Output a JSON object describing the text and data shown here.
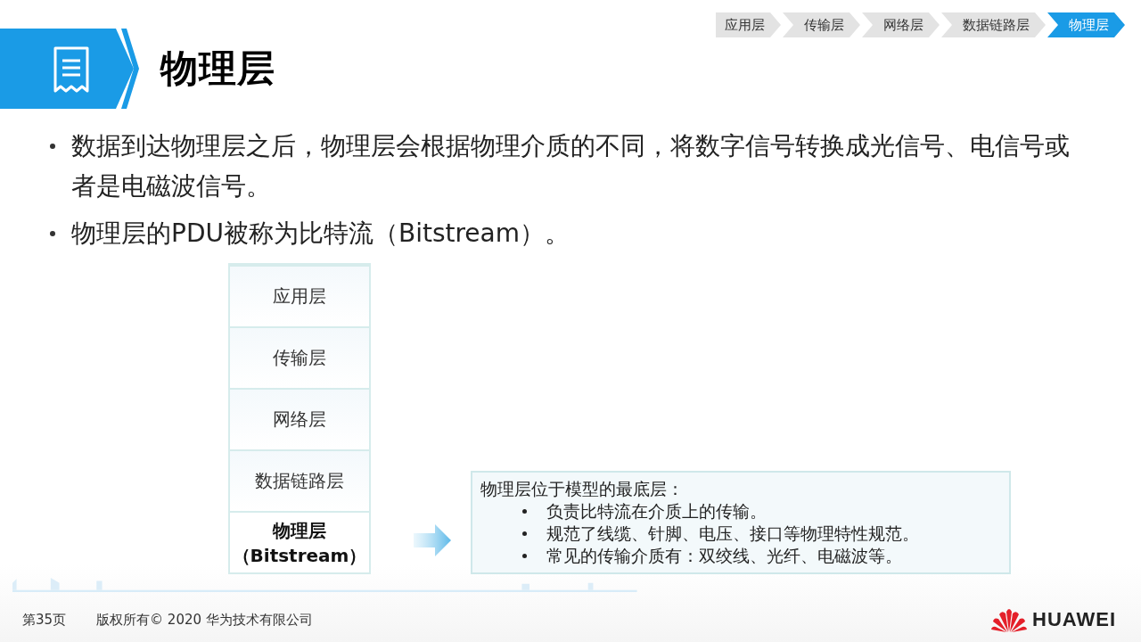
{
  "breadcrumb": [
    {
      "label": "应用层",
      "selected": false
    },
    {
      "label": "传输层",
      "selected": false
    },
    {
      "label": "网络层",
      "selected": false
    },
    {
      "label": "数据链路层",
      "selected": false
    },
    {
      "label": "物理层",
      "selected": true
    }
  ],
  "title": "物理层",
  "bullets": [
    "数据到达物理层之后，物理层会根据物理介质的不同，将数字信号转换成光信号、电信号或者是电磁波信号。",
    "物理层的PDU被称为比特流（Bitstream）。"
  ],
  "layers": [
    {
      "name": "应用层",
      "selected": false
    },
    {
      "name": "传输层",
      "selected": false
    },
    {
      "name": "网络层",
      "selected": false
    },
    {
      "name": "数据链路层",
      "selected": false
    },
    {
      "name": "物理层",
      "sub": "（Bitstream）",
      "selected": true
    }
  ],
  "callout": {
    "heading": "物理层位于模型的最底层：",
    "items": [
      "负责比特流在介质上的传输。",
      "规范了线缆、针脚、电压、接口等物理特性规范。",
      "常见的传输介质有：双绞线、光纤、电磁波等。"
    ]
  },
  "footer": {
    "page": "第35页",
    "copyright": "版权所有© 2020 华为技术有限公司"
  },
  "logo": {
    "text": "HUAWEI"
  }
}
